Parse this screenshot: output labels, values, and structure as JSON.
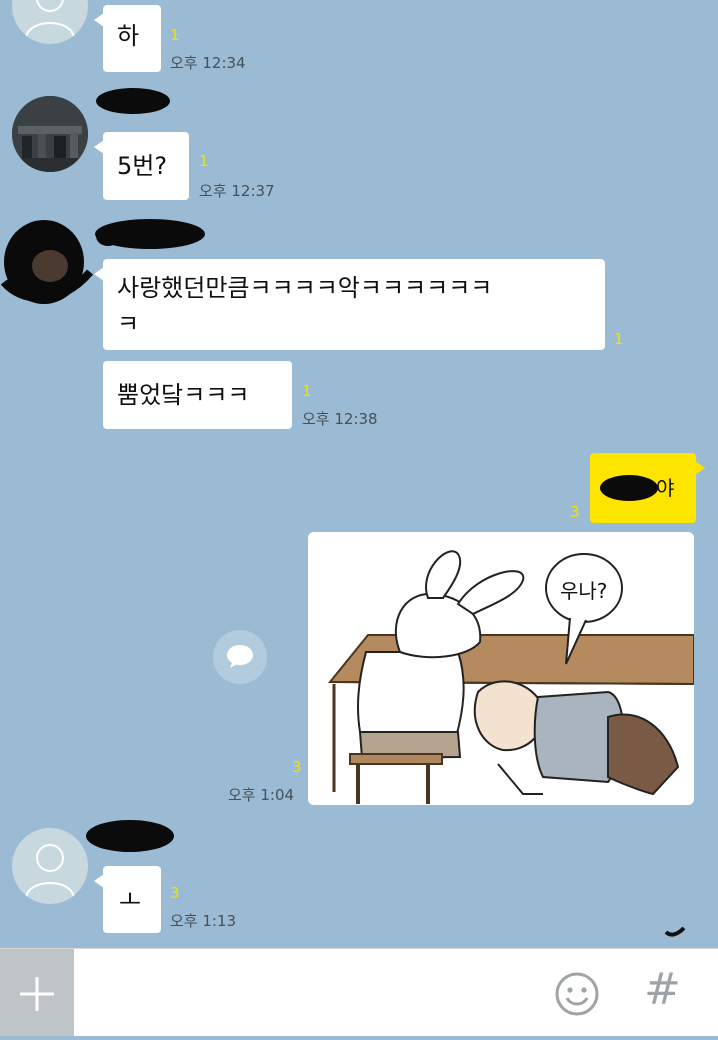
{
  "messages": [
    {
      "text": "하",
      "unread": "1",
      "time": "오후 12:34"
    },
    {
      "text": "5번?",
      "unread": "1",
      "time": "오후 12:37"
    },
    {
      "line1": "사랑했던만큼ㅋㅋㅋㅋ악ㅋㅋㅋㅋㅋㅋ",
      "line2": "ㅋ",
      "unread": "1"
    },
    {
      "text": "뿜었닼ㅋㅋㅋ",
      "unread": "1",
      "time": "오후 12:38"
    },
    {
      "text": "야",
      "unread": "3"
    },
    {
      "caption": "우나?",
      "unread": "3",
      "time": "오후 1:04"
    },
    {
      "text": "ㅗ",
      "unread": "3",
      "time": "오후 1:13"
    }
  ],
  "composer": {
    "input_placeholder": "",
    "plus_icon": "plus-icon",
    "emoji_icon": "emoticon-icon",
    "hash_label": "#"
  },
  "colors": {
    "background": "#9bbbd4",
    "my_bubble": "#fee500",
    "their_bubble": "#ffffff",
    "unread": "#f2e200"
  }
}
